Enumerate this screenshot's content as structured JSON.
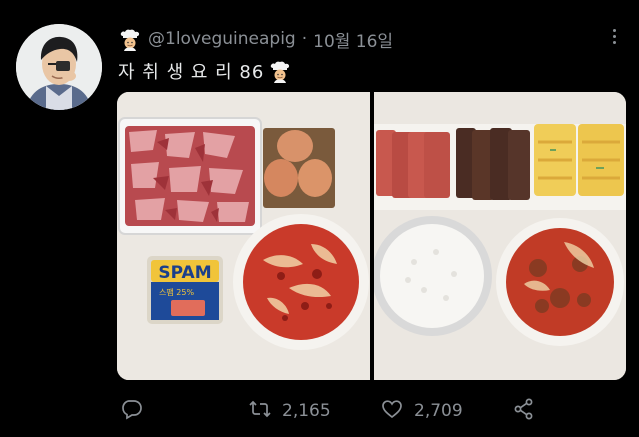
{
  "tweet": {
    "handle": "@1loveguineapig",
    "separator": "·",
    "date": "10월 16일",
    "text": "자 취 생 요 리 86",
    "retweets": "2,165",
    "likes": "2,709"
  },
  "icons": {
    "author": "chef-emoji-icon",
    "more": "more-dots-icon",
    "reply": "reply-icon",
    "retweet": "retweet-icon",
    "like": "heart-icon",
    "share": "share-icon"
  },
  "photos": [
    {
      "caption": "",
      "items": [
        "raw-pork",
        "eggs",
        "spam-can",
        "kimchi"
      ]
    },
    {
      "caption": "",
      "items": [
        "sliced-spam",
        "cooked-pork",
        "egg-roll",
        "rice",
        "kimchi-stew"
      ]
    }
  ],
  "spam_label": {
    "brand": "SPAM",
    "sub": "스팸 25%"
  },
  "colors": {
    "background": "#000000",
    "text": "#e7e9ea",
    "muted": "#8b9096"
  }
}
